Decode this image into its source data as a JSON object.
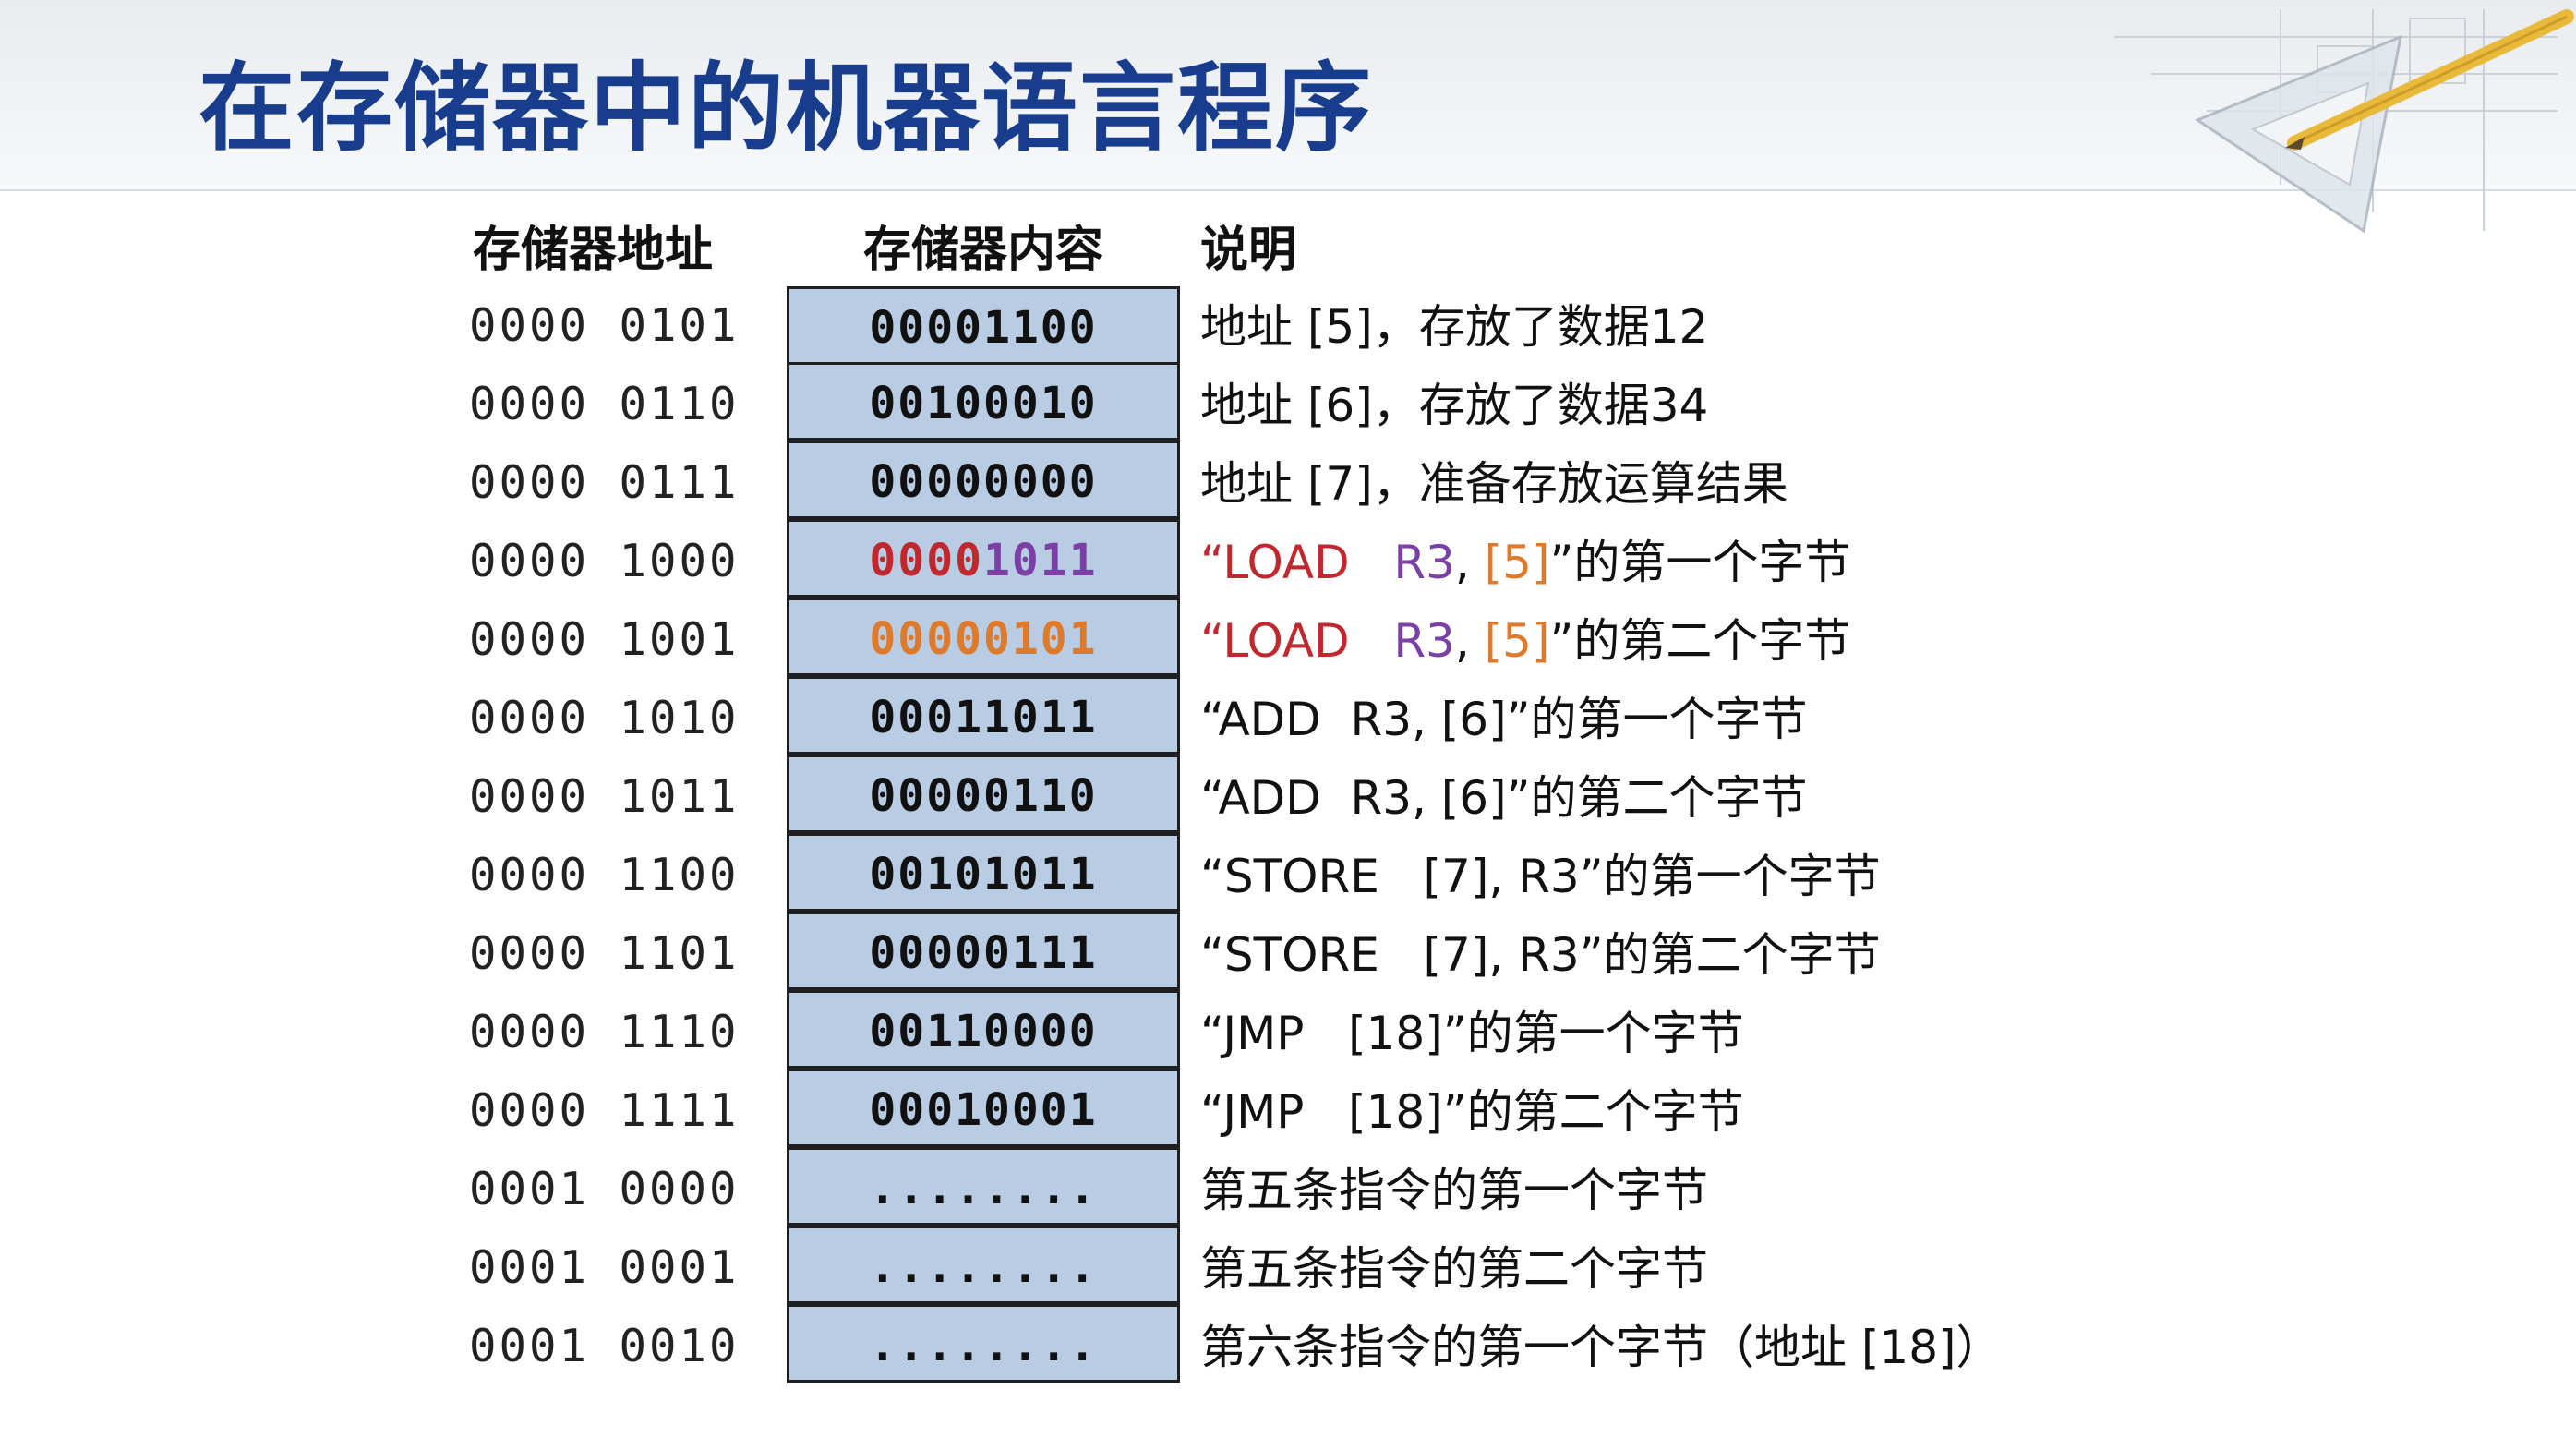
{
  "title": "在存储器中的机器语言程序",
  "headers": {
    "address": "存储器地址",
    "content": "存储器内容",
    "description": "说明"
  },
  "colors": {
    "title": "#173d8c",
    "cell_fill": "#b8cce4",
    "red": "#c0282d",
    "purple": "#7b3fa6",
    "orange": "#dd7a2c"
  },
  "rows": [
    {
      "address": "0000 0101",
      "content": [
        {
          "text": "00001100",
          "color": "default"
        }
      ],
      "description": [
        {
          "text": "地址 [5]，存放了数据12",
          "color": "default"
        }
      ]
    },
    {
      "address": "0000 0110",
      "content": [
        {
          "text": "00100010",
          "color": "default"
        }
      ],
      "description": [
        {
          "text": "地址 [6]，存放了数据34",
          "color": "default"
        }
      ]
    },
    {
      "address": "0000 0111",
      "content": [
        {
          "text": "00000000",
          "color": "default"
        }
      ],
      "description": [
        {
          "text": "地址 [7]，准备存放运算结果",
          "color": "default"
        }
      ]
    },
    {
      "address": "0000 1000",
      "content": [
        {
          "text": "0000",
          "color": "red"
        },
        {
          "text": "1011",
          "color": "purple"
        }
      ],
      "description": [
        {
          "text": "“LOAD   ",
          "color": "red"
        },
        {
          "text": "R3",
          "color": "purple"
        },
        {
          "text": ", ",
          "color": "default"
        },
        {
          "text": "[5]",
          "color": "orange"
        },
        {
          "text": "”的第一个字节",
          "color": "default"
        }
      ]
    },
    {
      "address": "0000 1001",
      "content": [
        {
          "text": "00000101",
          "color": "orange"
        }
      ],
      "description": [
        {
          "text": "“LOAD   ",
          "color": "red"
        },
        {
          "text": "R3",
          "color": "purple"
        },
        {
          "text": ", ",
          "color": "default"
        },
        {
          "text": "[5]",
          "color": "orange"
        },
        {
          "text": "”的第二个字节",
          "color": "default"
        }
      ]
    },
    {
      "address": "0000 1010",
      "content": [
        {
          "text": "00011011",
          "color": "default"
        }
      ],
      "description": [
        {
          "text": "“ADD  R3, [6]”的第一个字节",
          "color": "default"
        }
      ]
    },
    {
      "address": "0000 1011",
      "content": [
        {
          "text": "00000110",
          "color": "default"
        }
      ],
      "description": [
        {
          "text": "“ADD  R3, [6]”的第二个字节",
          "color": "default"
        }
      ]
    },
    {
      "address": "0000 1100",
      "content": [
        {
          "text": "00101011",
          "color": "default"
        }
      ],
      "description": [
        {
          "text": "“STORE   [7], R3”的第一个字节",
          "color": "default"
        }
      ]
    },
    {
      "address": "0000 1101",
      "content": [
        {
          "text": "00000111",
          "color": "default"
        }
      ],
      "description": [
        {
          "text": "“STORE   [7], R3”的第二个字节",
          "color": "default"
        }
      ]
    },
    {
      "address": "0000 1110",
      "content": [
        {
          "text": "00110000",
          "color": "default"
        }
      ],
      "description": [
        {
          "text": "“JMP   [18]”的第一个字节",
          "color": "default"
        }
      ]
    },
    {
      "address": "0000 1111",
      "content": [
        {
          "text": "00010001",
          "color": "default"
        }
      ],
      "description": [
        {
          "text": "“JMP   [18]”的第二个字节",
          "color": "default"
        }
      ]
    },
    {
      "address": "0001 0000",
      "content": [
        {
          "text": "........",
          "color": "default"
        }
      ],
      "description": [
        {
          "text": "第五条指令的第一个字节",
          "color": "default"
        }
      ]
    },
    {
      "address": "0001 0001",
      "content": [
        {
          "text": "........",
          "color": "default"
        }
      ],
      "description": [
        {
          "text": "第五条指令的第二个字节",
          "color": "default"
        }
      ]
    },
    {
      "address": "0001 0010",
      "content": [
        {
          "text": "........",
          "color": "default"
        }
      ],
      "description": [
        {
          "text": "第六条指令的第一个字节（地址 [18]）",
          "color": "default"
        }
      ]
    }
  ]
}
